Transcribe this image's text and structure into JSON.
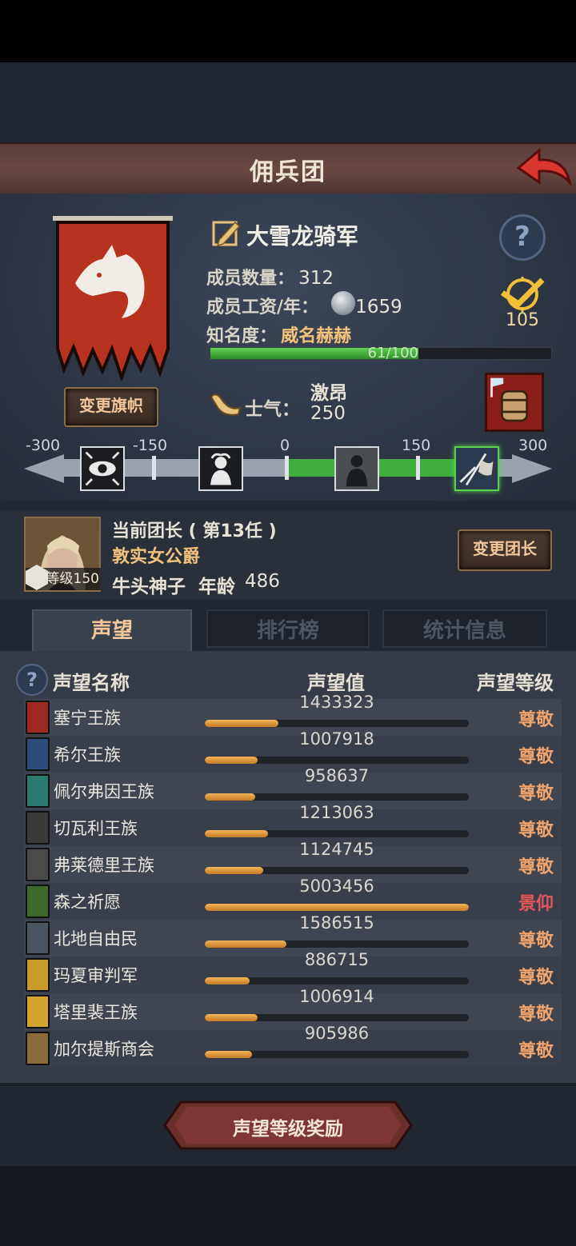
{
  "header": {
    "title": "佣兵团"
  },
  "legion": {
    "name": "大雪龙骑军",
    "members_label": "成员数量：",
    "members_value": "312",
    "wage_label": "成员工资/年：",
    "wage_value": "1659",
    "fame_label": "知名度：",
    "fame_value": "威名赫赫",
    "fame_progress_text": "61/100",
    "fame_progress": 0.61,
    "achievement_count": "105",
    "change_banner_label": "变更旗帜"
  },
  "morale": {
    "label": "士气：",
    "state": "激昂",
    "value": "250",
    "scale_labels": [
      "-300",
      "-150",
      "0",
      "150",
      "300"
    ]
  },
  "leader": {
    "heading": "当前团长 ( 第13任 )",
    "title": "敦实女公爵",
    "level": "等级150",
    "race": "牛头神子",
    "age_label": "年龄",
    "age": "486",
    "change_label": "变更团长"
  },
  "tabs": [
    {
      "label": "声望",
      "active": true
    },
    {
      "label": "排行榜",
      "active": false
    },
    {
      "label": "统计信息",
      "active": false
    }
  ],
  "table": {
    "headers": {
      "name": "声望名称",
      "value": "声望值",
      "level": "声望等级"
    },
    "rows": [
      {
        "name": "塞宁王族",
        "value": "1433323",
        "level": "尊敬",
        "progress": 0.28,
        "level_color": "#f0a36a",
        "icon_color": "#9c2a22"
      },
      {
        "name": "希尔王族",
        "value": "1007918",
        "level": "尊敬",
        "progress": 0.2,
        "level_color": "#f0a36a",
        "icon_color": "#2b4c78"
      },
      {
        "name": "佩尔弗因王族",
        "value": "958637",
        "level": "尊敬",
        "progress": 0.19,
        "level_color": "#f0a36a",
        "icon_color": "#2f7a70"
      },
      {
        "name": "切瓦利王族",
        "value": "1213063",
        "level": "尊敬",
        "progress": 0.24,
        "level_color": "#f0a36a",
        "icon_color": "#3a3a3a"
      },
      {
        "name": "弗莱德里王族",
        "value": "1124745",
        "level": "尊敬",
        "progress": 0.22,
        "level_color": "#f0a36a",
        "icon_color": "#4a4a4a"
      },
      {
        "name": "森之祈愿",
        "value": "5003456",
        "level": "景仰",
        "progress": 1.0,
        "level_color": "#e2565a",
        "icon_color": "#3d6a2c"
      },
      {
        "name": "北地自由民",
        "value": "1586515",
        "level": "尊敬",
        "progress": 0.31,
        "level_color": "#f0a36a",
        "icon_color": "#4b5562"
      },
      {
        "name": "玛夏审判军",
        "value": "886715",
        "level": "尊敬",
        "progress": 0.17,
        "level_color": "#f0a36a",
        "icon_color": "#c89a2a"
      },
      {
        "name": "塔里裴王族",
        "value": "1006914",
        "level": "尊敬",
        "progress": 0.2,
        "level_color": "#f0a36a",
        "icon_color": "#d4a52e"
      },
      {
        "name": "加尔提斯商会",
        "value": "905986",
        "level": "尊敬",
        "progress": 0.18,
        "level_color": "#f0a36a",
        "icon_color": "#8a6a3a"
      }
    ]
  },
  "footer": {
    "reward_label": "声望等级奖励"
  }
}
